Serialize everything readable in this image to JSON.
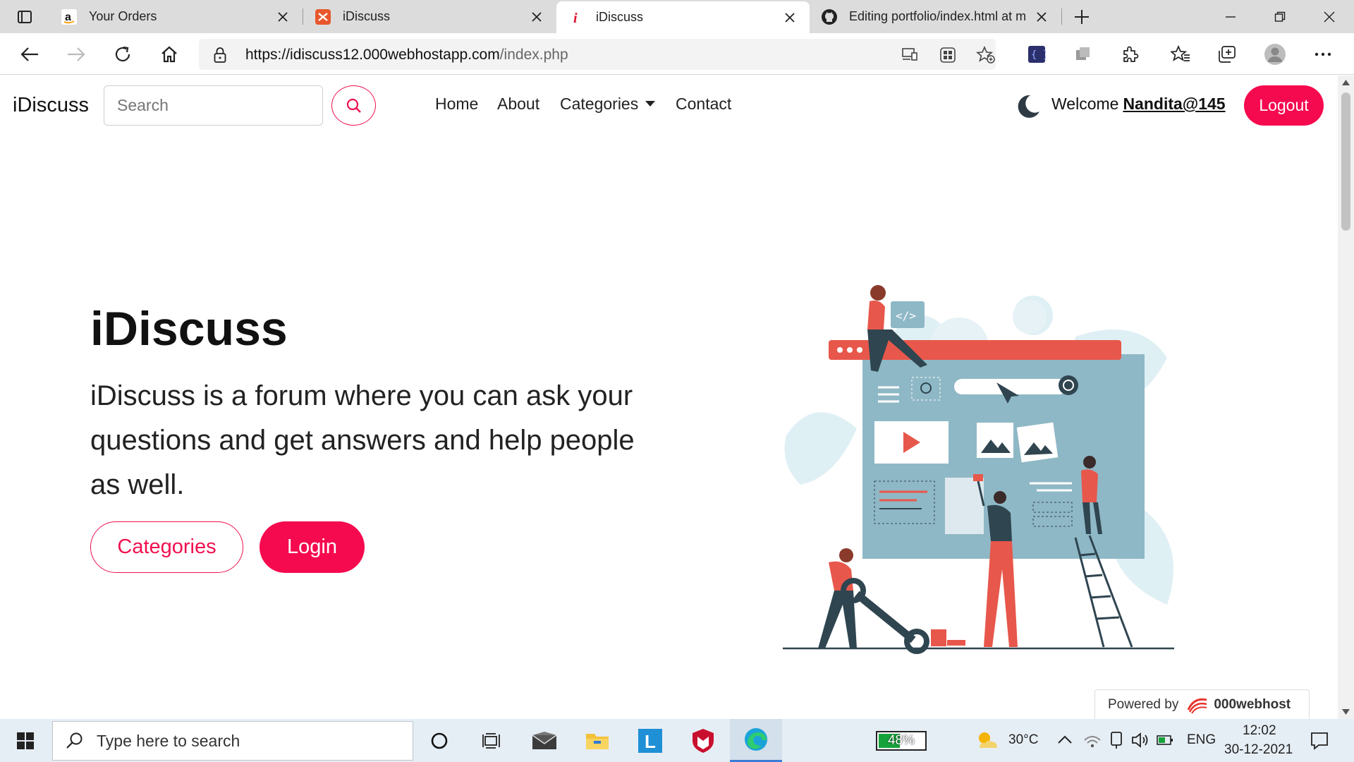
{
  "browser": {
    "tabs": [
      {
        "title": "Your Orders",
        "icon": "amazon-icon",
        "active": false
      },
      {
        "title": "iDiscuss",
        "icon": "webhost-icon",
        "active": false
      },
      {
        "title": "iDiscuss",
        "icon": "idiscuss-icon",
        "active": true
      },
      {
        "title": "Editing portfolio/index.html at m",
        "icon": "github-icon",
        "active": false
      }
    ],
    "url_domain": "https://idiscuss12.000webhostapp.com",
    "url_path": "/index.php"
  },
  "navbar": {
    "brand": "iDiscuss",
    "search_placeholder": "Search",
    "links": {
      "home": "Home",
      "about": "About",
      "categories": "Categories",
      "contact": "Contact"
    },
    "welcome": "Welcome",
    "username": "Nandita@145",
    "logout": "Logout"
  },
  "hero": {
    "title": "iDiscuss",
    "description": "iDiscuss is a forum where you can ask your questions and get answers and help people as well.",
    "categories_button": "Categories",
    "login_button": "Login"
  },
  "footer_badge": {
    "powered_by": "Powered by",
    "brand": "000webhost"
  },
  "taskbar": {
    "search_placeholder": "Type here to search",
    "battery": "48%",
    "temperature": "30°C",
    "language": "ENG",
    "time": "12:02",
    "date": "30-12-2021"
  },
  "colors": {
    "accent": "#f5094f",
    "illustration_blue": "#8fb8c6",
    "illustration_red": "#e8574b",
    "illustration_dark": "#2f4550"
  }
}
